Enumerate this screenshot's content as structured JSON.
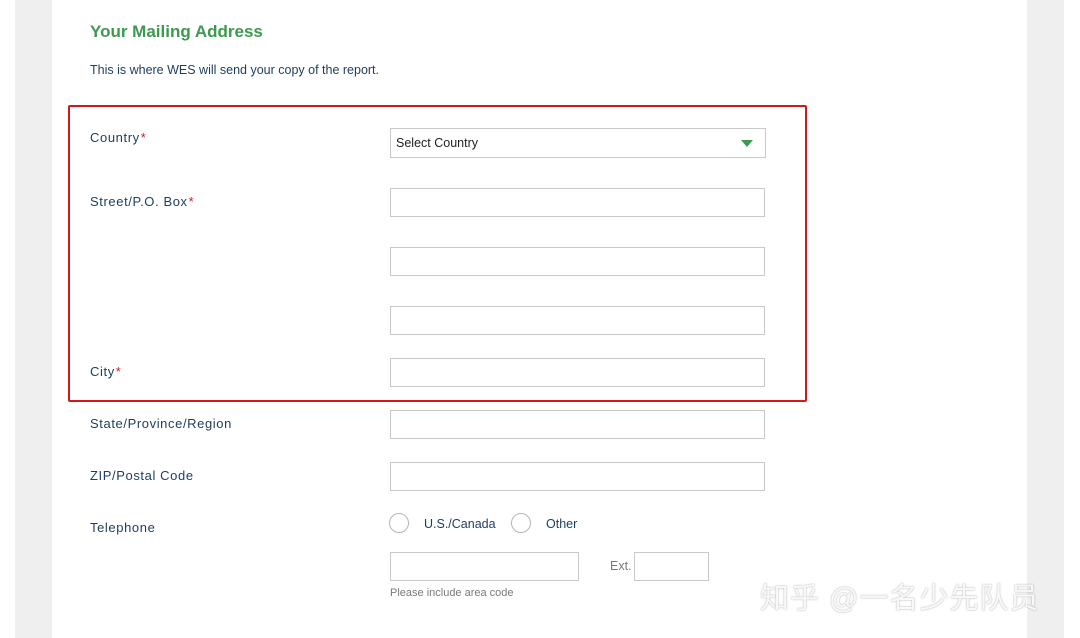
{
  "section": {
    "title": "Your Mailing Address",
    "description": "This is where WES will send your copy of the report."
  },
  "fields": {
    "country": {
      "label": "Country",
      "required_mark": "*",
      "selected": "Select Country"
    },
    "street": {
      "label": "Street/P.O. Box",
      "required_mark": "*",
      "line1": "",
      "line2": "",
      "line3": ""
    },
    "city": {
      "label": "City",
      "required_mark": "*",
      "value": ""
    },
    "state": {
      "label": "State/Province/Region",
      "value": ""
    },
    "zip": {
      "label": "ZIP/Postal Code",
      "value": ""
    },
    "telephone": {
      "label": "Telephone",
      "options": [
        "U.S./Canada",
        "Other"
      ],
      "number": "",
      "ext_label": "Ext.",
      "ext_value": "",
      "hint": "Please include area code"
    }
  },
  "colors": {
    "accent": "#3c9a4e",
    "required": "#d0191c",
    "highlight_border": "#d0191c",
    "text": "#1d3d5e"
  },
  "watermark": "知乎 @一名少先队员"
}
